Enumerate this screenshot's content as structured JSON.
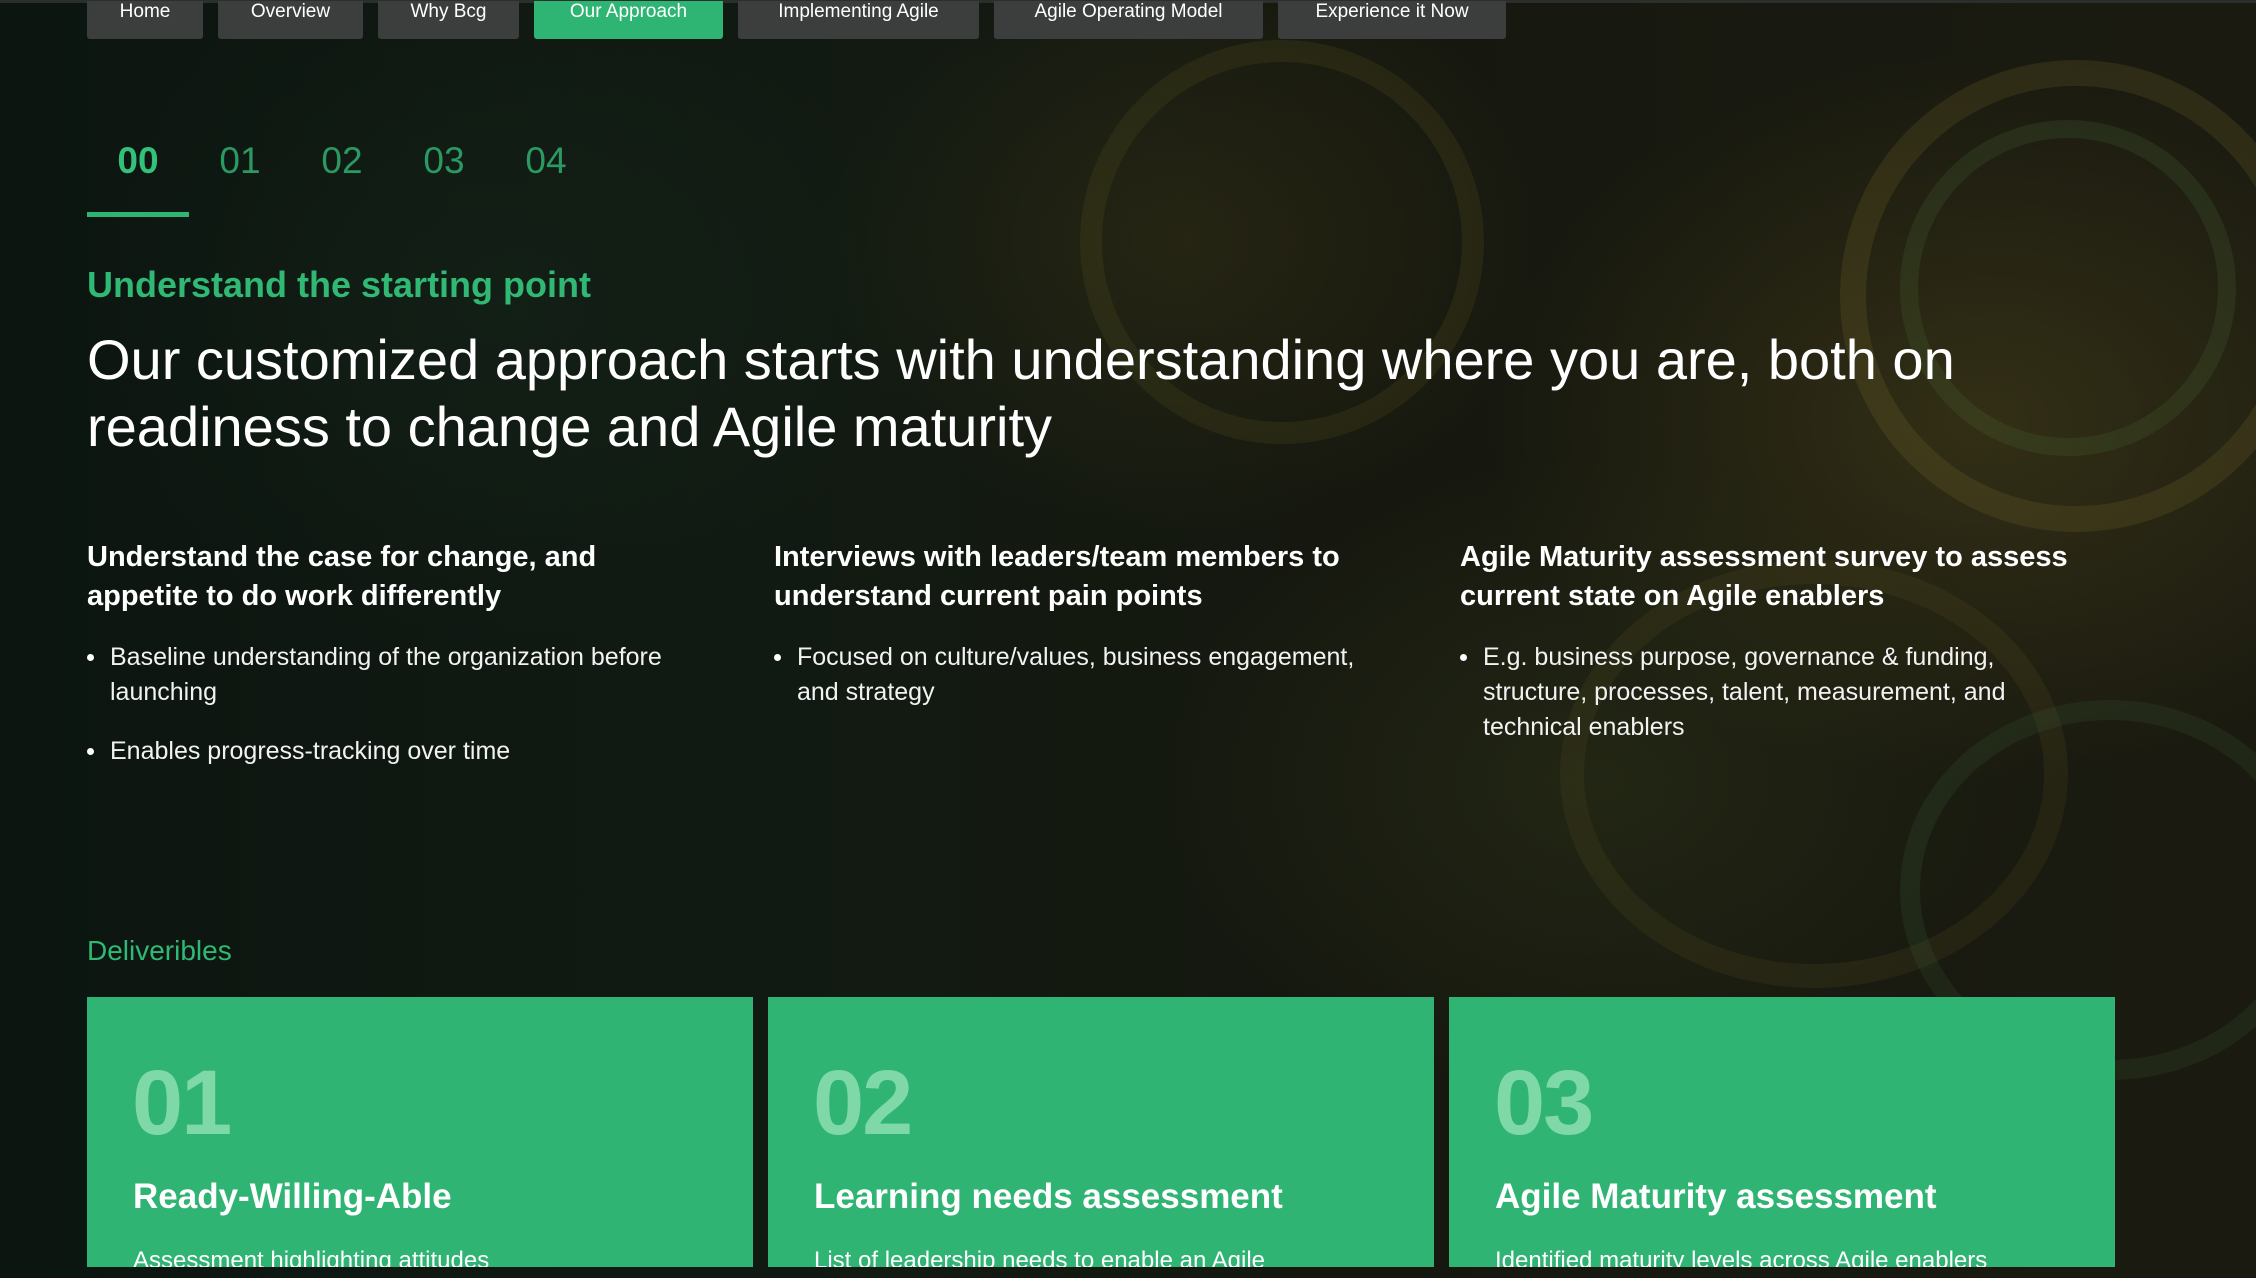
{
  "nav": {
    "items": [
      {
        "label": "Home",
        "active": false
      },
      {
        "label": "Overview",
        "active": false
      },
      {
        "label": "Why Bcg",
        "active": false
      },
      {
        "label": "Our Approach",
        "active": true
      },
      {
        "label": "Implementing Agile",
        "active": false
      },
      {
        "label": "Agile Operating Model",
        "active": false
      },
      {
        "label": "Experience it Now",
        "active": false
      }
    ]
  },
  "steps": {
    "items": [
      "00",
      "01",
      "02",
      "03",
      "04"
    ],
    "active_index": 0
  },
  "section": {
    "eyebrow": "Understand the starting point",
    "headline": "Our customized approach starts with understanding where you are, both on readiness to change and Agile maturity"
  },
  "columns": [
    {
      "title": "Understand the case for change, and appetite to do work differently",
      "bullets": [
        "Baseline understanding of the organization before launching",
        "Enables progress-tracking over time"
      ]
    },
    {
      "title": "Interviews with leaders/team members to understand current pain points",
      "bullets": [
        "Focused on culture/values, business engagement, and strategy"
      ]
    },
    {
      "title": "Agile Maturity assessment survey to assess current state on Agile enablers",
      "bullets": [
        "E.g. business purpose, governance & funding, structure, processes, talent, measurement, and technical enablers"
      ]
    }
  ],
  "deliverables": {
    "label": "Deliveribles",
    "cards": [
      {
        "number": "01",
        "title": "Ready-Willing-Able",
        "description": "Assessment highlighting attitudes"
      },
      {
        "number": "02",
        "title": "Learning needs assessment",
        "description": "List of leadership needs to enable an Agile"
      },
      {
        "number": "03",
        "title": "Agile Maturity assessment",
        "description": "Identified maturity levels across Agile enablers"
      }
    ]
  },
  "colors": {
    "accent": "#2fb573",
    "nav_inactive": "#3c3e3d",
    "card": "#30b474",
    "card_number": "#7fd8a8",
    "background": "#0d140f"
  }
}
